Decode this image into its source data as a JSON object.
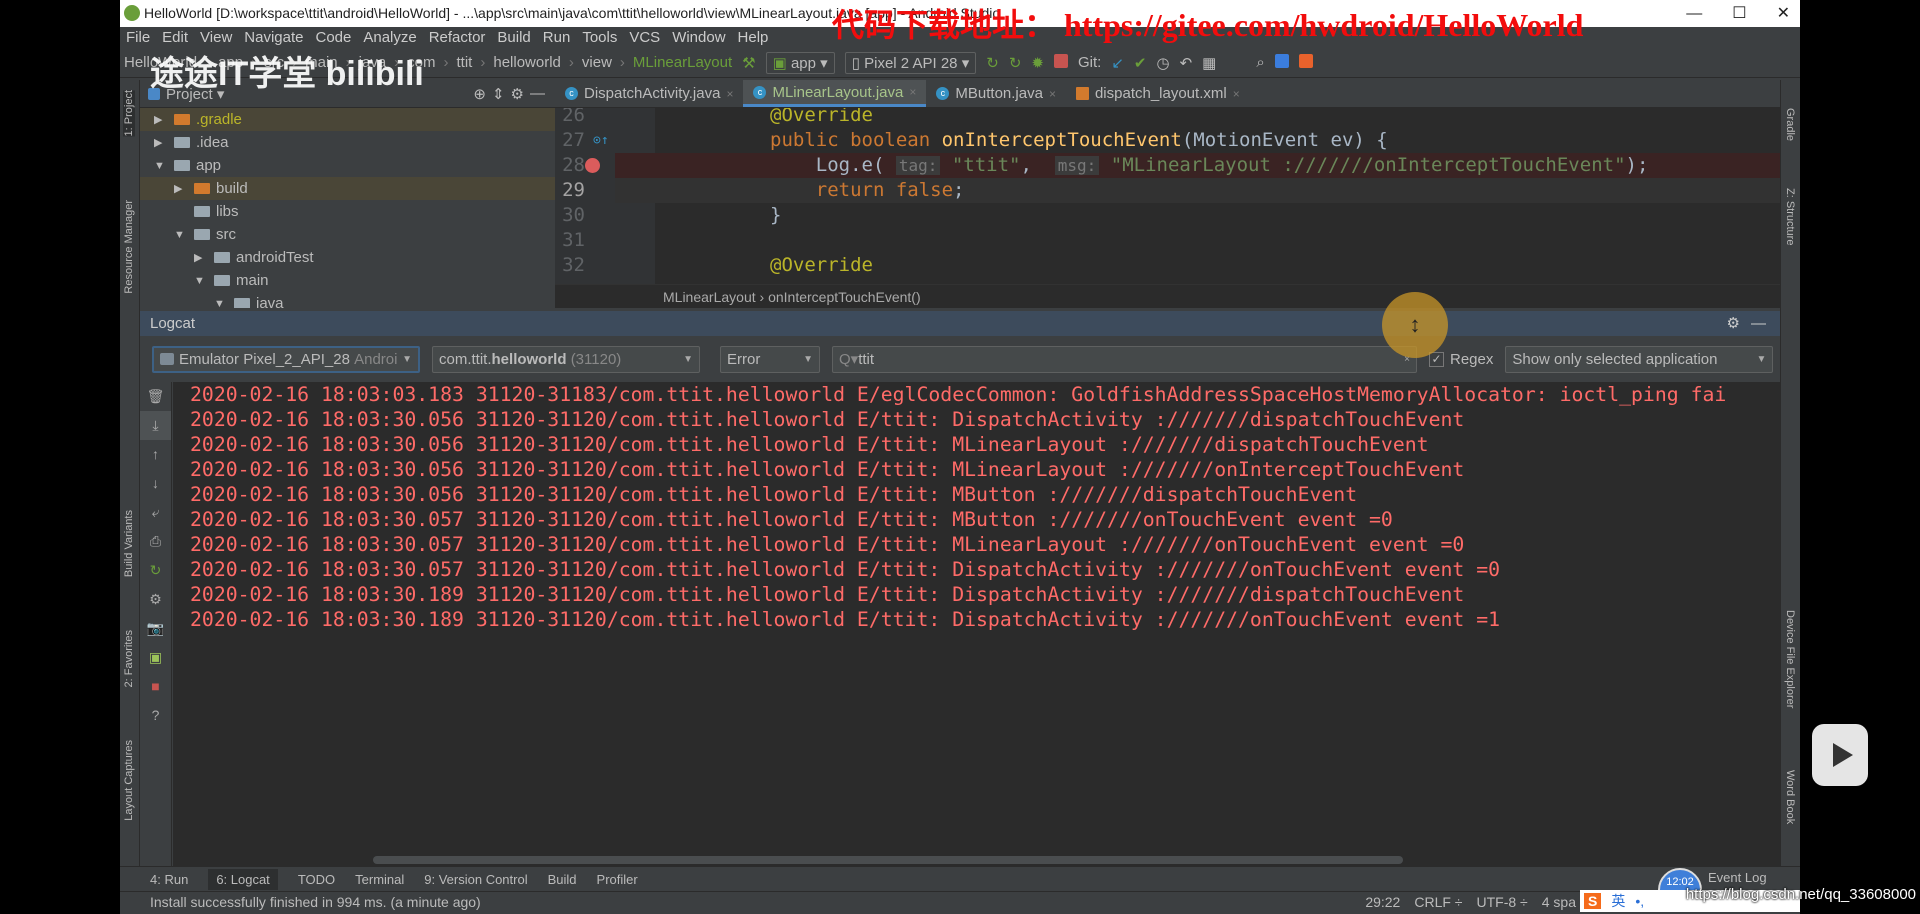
{
  "window": {
    "title": "HelloWorld [D:\\workspace\\ttit\\android\\HelloWorld] - ...\\app\\src\\main\\java\\com\\ttit\\helloworld\\view\\MLinearLayout.java [app] - Android Studio",
    "controls": [
      "—",
      "☐",
      "✕"
    ]
  },
  "overlay": {
    "watermark": "代码下载地址： https://gitee.com/hwdroid/HelloWorld",
    "channel": "途途IT学堂 bilibili",
    "url": "https://blog.csdn.net/qq_33608000",
    "clock": "12:02",
    "ime": "英"
  },
  "menu": [
    "File",
    "Edit",
    "View",
    "Navigate",
    "Code",
    "Analyze",
    "Refactor",
    "Build",
    "Run",
    "Tools",
    "VCS",
    "Window",
    "Help"
  ],
  "navbar": {
    "crumbs": [
      "HelloWorld",
      "app",
      "src",
      "main",
      "java",
      "com",
      "ttit",
      "helloworld",
      "view",
      "MLinearLayout"
    ],
    "run_config": "app",
    "device": "Pixel 2 API 28",
    "git_label": "Git:"
  },
  "project": {
    "title": "Project",
    "tree": [
      {
        "label": ".gradle",
        "depth": 0,
        "arrow": "▶",
        "color": "orange",
        "hl": true
      },
      {
        "label": ".idea",
        "depth": 0,
        "arrow": "▶"
      },
      {
        "label": "app",
        "depth": 0,
        "arrow": "▼"
      },
      {
        "label": "build",
        "depth": 1,
        "arrow": "▶",
        "color": "orange",
        "hl": true
      },
      {
        "label": "libs",
        "depth": 1,
        "arrow": ""
      },
      {
        "label": "src",
        "depth": 1,
        "arrow": "▼"
      },
      {
        "label": "androidTest",
        "depth": 2,
        "arrow": "▶"
      },
      {
        "label": "main",
        "depth": 2,
        "arrow": "▼"
      },
      {
        "label": "java",
        "depth": 3,
        "arrow": "▼"
      }
    ]
  },
  "left_stripe": [
    "1: Project",
    "Resource Manager",
    "Build Variants",
    "2: Favorites",
    "Layout Captures"
  ],
  "right_stripe": [
    "Gradle",
    "Z: Structure",
    "Device File Explorer",
    "Word Book"
  ],
  "tabs": [
    {
      "label": "DispatchActivity.java",
      "active": false
    },
    {
      "label": "MLinearLayout.java",
      "active": true
    },
    {
      "label": "MButton.java",
      "active": false
    },
    {
      "label": "dispatch_layout.xml",
      "active": false
    }
  ],
  "editor": {
    "lines": [
      {
        "n": "26",
        "segs": [
          [
            "an",
            "@Override"
          ]
        ]
      },
      {
        "n": "27",
        "segs": [
          [
            "kw",
            "public boolean "
          ],
          [
            "fn",
            "onInterceptTouchEvent"
          ],
          [
            "pl",
            "(MotionEvent ev) {"
          ]
        ]
      },
      {
        "n": "28",
        "bp": true,
        "segs": [
          [
            "pl",
            "    Log."
          ],
          [
            "pl",
            "e( "
          ],
          [
            "hint",
            "tag:"
          ],
          [
            "st",
            " \"ttit\""
          ],
          [
            "pl",
            ",  "
          ],
          [
            "hint",
            "msg:"
          ],
          [
            "st",
            " \"MLinearLayout :///////onInterceptTouchEvent\""
          ],
          [
            "pl",
            ");"
          ]
        ]
      },
      {
        "n": "29",
        "cur": true,
        "segs": [
          [
            "kw",
            "    return false"
          ],
          [
            "pl",
            ";"
          ]
        ]
      },
      {
        "n": "30",
        "segs": [
          [
            "pl",
            "}"
          ]
        ]
      },
      {
        "n": "31",
        "segs": []
      },
      {
        "n": "32",
        "segs": [
          [
            "an",
            "@Override"
          ]
        ]
      }
    ],
    "breadcrumb": [
      "MLinearLayout",
      "onInterceptTouchEvent()"
    ]
  },
  "logcat": {
    "title": "Logcat",
    "device": "Emulator Pixel_2_API_28",
    "device_suffix": "Androi",
    "process": "com.ttit.",
    "process_bold": "helloworld",
    "pid": "(31120)",
    "level": "Error",
    "search": "ttit",
    "regex_label": "Regex",
    "regex_checked": true,
    "scope": "Show only selected application",
    "lines": [
      "2020-02-16 18:03:03.183 31120-31183/com.ttit.helloworld E/eglCodecCommon: GoldfishAddressSpaceHostMemoryAllocator: ioctl_ping fai",
      "2020-02-16 18:03:30.056 31120-31120/com.ttit.helloworld E/ttit: DispatchActivity :///////dispatchTouchEvent",
      "2020-02-16 18:03:30.056 31120-31120/com.ttit.helloworld E/ttit: MLinearLayout :///////dispatchTouchEvent",
      "2020-02-16 18:03:30.056 31120-31120/com.ttit.helloworld E/ttit: MLinearLayout :///////onInterceptTouchEvent",
      "2020-02-16 18:03:30.056 31120-31120/com.ttit.helloworld E/ttit: MButton :///////dispatchTouchEvent",
      "2020-02-16 18:03:30.057 31120-31120/com.ttit.helloworld E/ttit: MButton :///////onTouchEvent event =0",
      "2020-02-16 18:03:30.057 31120-31120/com.ttit.helloworld E/ttit: MLinearLayout :///////onTouchEvent event =0",
      "2020-02-16 18:03:30.057 31120-31120/com.ttit.helloworld E/ttit: DispatchActivity :///////onTouchEvent event =0",
      "2020-02-16 18:03:30.189 31120-31120/com.ttit.helloworld E/ttit: DispatchActivity :///////dispatchTouchEvent",
      "2020-02-16 18:03:30.189 31120-31120/com.ttit.helloworld E/ttit: DispatchActivity :///////onTouchEvent event =1"
    ],
    "color": "#ff6b68"
  },
  "bottom_tabs": [
    "4: Run",
    "6: Logcat",
    "TODO",
    "Terminal",
    "9: Version Control",
    "Build",
    "Profiler"
  ],
  "event_log": "Event Log",
  "status": {
    "message": "Install successfully finished in 994 ms. (a minute ago)",
    "position": "29:22",
    "line_sep": "CRLF ÷",
    "encoding": "UTF-8 ÷",
    "indent": "4 spa"
  }
}
